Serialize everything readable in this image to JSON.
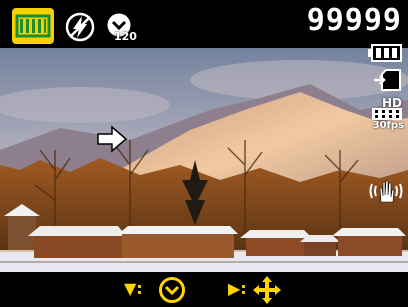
{
  "top_bar": {
    "scene_mode_icon": "film-frame-icon",
    "flash_icon": "flash-off-icon",
    "self_timer_icon": "self-timer-icon",
    "self_timer_value": "120",
    "shots_remaining": "99999"
  },
  "right_status": {
    "battery_icon": "battery-icon",
    "storage_icon": "memory-card-icon",
    "video_quality_label": "HD",
    "video_fps_label": "30fps",
    "stabilizer_icon": "hand-shake-icon"
  },
  "overlay": {
    "navigation_arrow_icon": "right-arrow-icon"
  },
  "bottom_hints": {
    "down_key_label": "▼:",
    "down_key_action_icon": "self-timer-icon",
    "right_key_label": "▶:",
    "right_key_action_icon": "four-way-navigation-icon"
  },
  "colors": {
    "hint_color": "#ffd400",
    "icon_color": "#ffffff",
    "scene_mode_bg": "#f5d000",
    "scene_mode_fg": "#1b8f2f"
  }
}
